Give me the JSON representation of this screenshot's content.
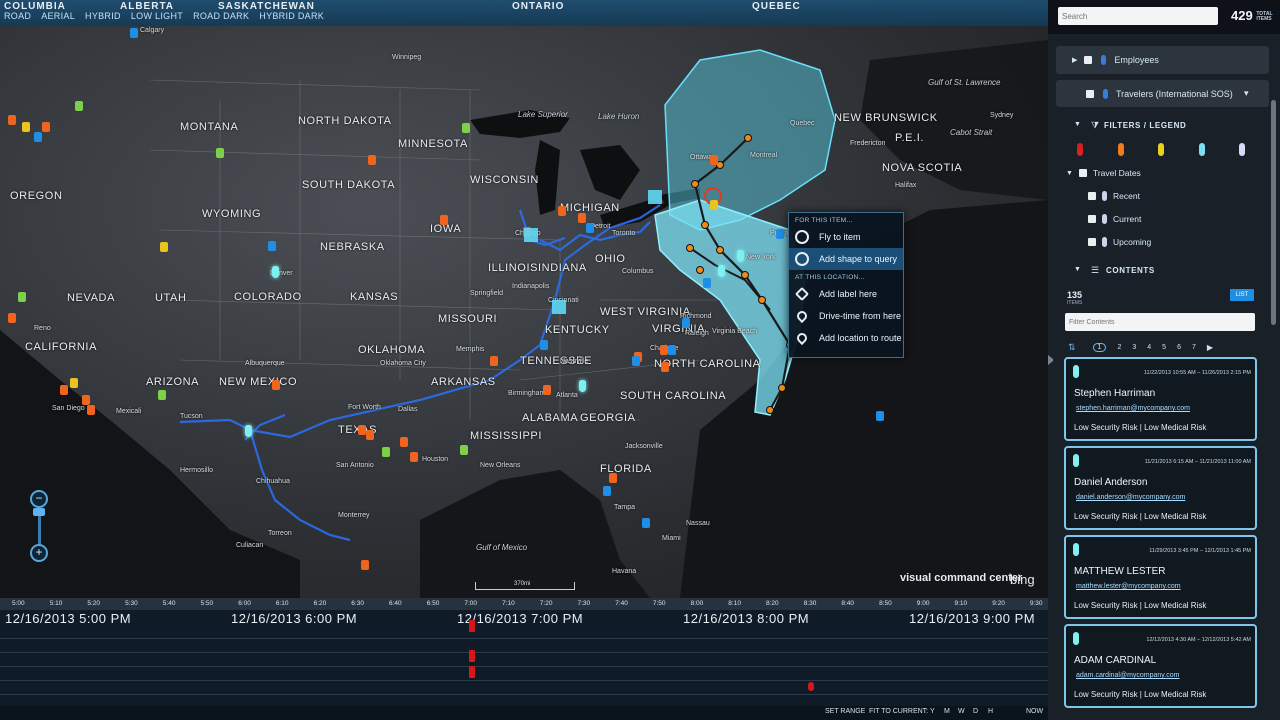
{
  "map": {
    "top_links": [
      "ROAD",
      "AERIAL",
      "HYBRID",
      "LOW LIGHT",
      "ROAD DARK",
      "HYBRID DARK"
    ],
    "countries": [
      "COLUMBIA",
      "ALBERTA",
      "SASKATCHEWAN",
      "ONTARIO",
      "QUEBEC"
    ],
    "states": [
      {
        "name": "MONTANA"
      },
      {
        "name": "NORTH DAKOTA"
      },
      {
        "name": "MINNESOTA"
      },
      {
        "name": "SOUTH DAKOTA"
      },
      {
        "name": "WISCONSIN"
      },
      {
        "name": "WYOMING"
      },
      {
        "name": "IOWA"
      },
      {
        "name": "NEBRASKA"
      },
      {
        "name": "ILLINOIS"
      },
      {
        "name": "INDIANA"
      },
      {
        "name": "OHIO"
      },
      {
        "name": "NEVADA"
      },
      {
        "name": "UTAH"
      },
      {
        "name": "COLORADO"
      },
      {
        "name": "KANSAS"
      },
      {
        "name": "MISSOURI"
      },
      {
        "name": "KENTUCKY"
      },
      {
        "name": "WEST VIRGINIA"
      },
      {
        "name": "VIRGINIA"
      },
      {
        "name": "CALIFORNIA"
      },
      {
        "name": "OKLAHOMA"
      },
      {
        "name": "TENNESSEE"
      },
      {
        "name": "NORTH CAROLINA"
      },
      {
        "name": "ARIZONA"
      },
      {
        "name": "NEW MEXICO"
      },
      {
        "name": "ARKANSAS"
      },
      {
        "name": "SOUTH CAROLINA"
      },
      {
        "name": "ALABAMA"
      },
      {
        "name": "GEORGIA"
      },
      {
        "name": "MISSISSIPPI"
      },
      {
        "name": "TEXAS"
      },
      {
        "name": "FLORIDA"
      },
      {
        "name": "OREGON"
      },
      {
        "name": "NEW BRUNSWICK"
      },
      {
        "name": "NOVA SCOTIA"
      },
      {
        "name": "P.E.I."
      },
      {
        "name": "MICHIGAN"
      }
    ],
    "water": [
      "Lake Superior",
      "Lake Huron",
      "Gulf of Mexico",
      "Gulf of St. Lawrence",
      "Cabot Strait"
    ],
    "cities": [
      "Winnipeg",
      "Calgary",
      "Fort Worth",
      "Dallas",
      "San Antonio",
      "Houston",
      "Tucson",
      "Hermosillo",
      "Chihuahua",
      "Culiacan",
      "Monterrey",
      "Torreon",
      "New Orleans",
      "Jacksonville",
      "Havana",
      "Birmingham",
      "Memphis",
      "Atlanta",
      "Columbus",
      "Indianapolis",
      "Cincinnati",
      "New York",
      "Portland",
      "Montreal",
      "Ottawa",
      "San Diego",
      "Reno",
      "Denver",
      "Albuquerque",
      "Mexicali",
      "Oklahoma City",
      "Nashville",
      "Charlotte",
      "Raleigh",
      "Richmond",
      "Virginia Beach",
      "Toronto",
      "Chicago",
      "Detroit",
      "Quebec",
      "Halifax",
      "Fredericton",
      "Sydney",
      "Miami",
      "Tampa",
      "Nassau",
      "Springfield"
    ],
    "scale_label": "370mi",
    "brand": "visual command center",
    "brand2": "bing",
    "context_menu": {
      "section1": "FOR THIS ITEM...",
      "fly_to_item": "Fly to item",
      "add_shape_to_query": "Add shape to query",
      "section2": "AT THIS LOCATION...",
      "add_label_here": "Add label here",
      "drive_time_from_here": "Drive-time from here",
      "add_location_to_route": "Add location to route"
    },
    "zoom": {
      "plus": "+",
      "minus": "−"
    }
  },
  "timeline": {
    "ticks": [
      "5:00",
      "5:10",
      "5:20",
      "5:30",
      "5:40",
      "5:50",
      "6:00",
      "6:10",
      "6:20",
      "6:30",
      "6:40",
      "6:50",
      "7:00",
      "7:10",
      "7:20",
      "7:30",
      "7:40",
      "7:50",
      "8:00",
      "8:10",
      "8:20",
      "8:30",
      "8:40",
      "8:50",
      "9:00",
      "9:10",
      "9:20",
      "9:30"
    ],
    "day_labels": [
      "12/16/2013 5:00 PM",
      "12/16/2013 6:00 PM",
      "12/16/2013 7:00 PM",
      "12/16/2013 8:00 PM",
      "12/16/2013 9:00 PM"
    ],
    "bottom": {
      "set_range": "SET RANGE",
      "fit_to_current": "FIT TO CURRENT:",
      "y": "Y",
      "m": "M",
      "w": "W",
      "d": "D",
      "h": "H",
      "now": "NOW"
    }
  },
  "sidebar": {
    "search_placeholder": "Search",
    "total_count": "429",
    "total_label": "TOTAL ITEMS",
    "layers": [
      {
        "label": "Employees"
      },
      {
        "label": "Travelers (International SOS)"
      }
    ],
    "filters_title": "FILTERS / LEGEND",
    "legend_colors": [
      "#d81f22",
      "#f07a1e",
      "#e8d21e",
      "#7de0f0",
      "#d6dcf5"
    ],
    "travel_dates_label": "Travel Dates",
    "filter_items": [
      "Recent",
      "Current",
      "Upcoming"
    ],
    "contents_title": "CONTENTS",
    "contents_count": "135",
    "contents_unit": "ITEMS",
    "list_button": "LIST",
    "filter_placeholder": "Filter Contents",
    "pages": [
      "1",
      "2",
      "3",
      "4",
      "5",
      "6",
      "7"
    ],
    "cards": [
      {
        "dates": "11/22/2013 10:55 AM – 11/26/2013 2:15 PM",
        "name": "Stephen Harriman",
        "email": "stephen.harriman@mycompany.com",
        "risk": "Low Security Risk | Low Medical Risk"
      },
      {
        "dates": "11/21/2013 6:15 AM – 11/21/2013 11:00 AM",
        "name": "Daniel Anderson",
        "email": "daniel.anderson@mycompany.com",
        "risk": "Low Security Risk | Low Medical Risk"
      },
      {
        "dates": "11/29/2013 3:45 PM – 12/1/2013 1:45 PM",
        "name": "MATTHEW LESTER",
        "email": "matthew.lester@mycompany.com",
        "risk": "Low Security Risk | Low Medical Risk"
      },
      {
        "dates": "12/12/2013 4:30 AM – 12/12/2013 5:42 AM",
        "name": "ADAM CARDINAL",
        "email": "adam.cardinal@mycompany.com",
        "risk": "Low Security Risk | Low Medical Risk"
      }
    ]
  }
}
